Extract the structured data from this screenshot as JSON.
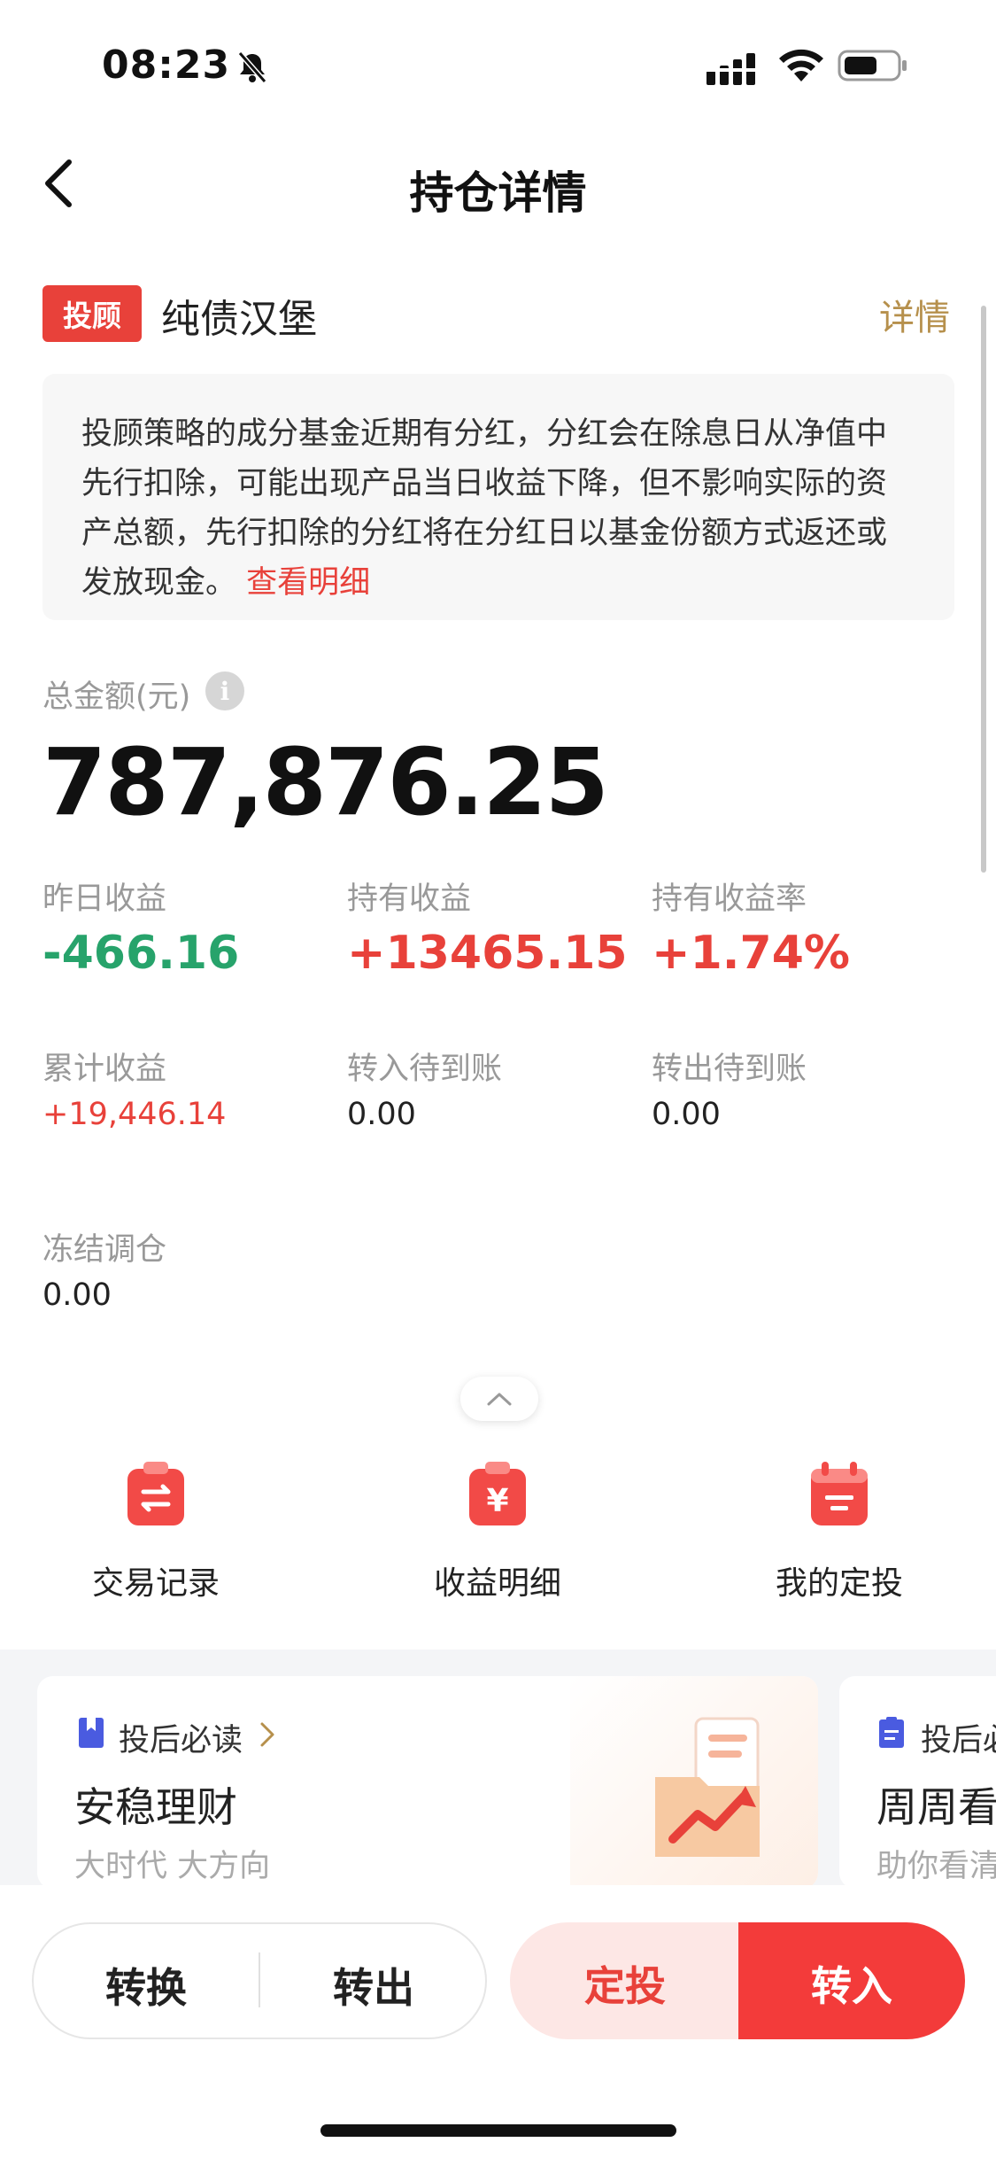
{
  "status_bar": {
    "time": "08:23",
    "icons": [
      "bell-mute-icon",
      "signal-icon",
      "wifi-icon",
      "battery-icon"
    ]
  },
  "nav": {
    "title": "持仓详情",
    "back_icon": "chevron-left-icon"
  },
  "product": {
    "tag": "投顾",
    "name": "纯债汉堡",
    "detail_link": "详情"
  },
  "notice": {
    "text": "投顾策略的成分基金近期有分红，分红会在除息日从净值中先行扣除，可能出现产品当日收益下降，但不影响实际的资产总额，先行扣除的分红将在分红日以基金份额方式返还或发放现金。",
    "link": "查看明细"
  },
  "total": {
    "label": "总金额(元)",
    "info_icon": "i",
    "value": "787,876.25"
  },
  "stats": {
    "yesterday_label": "昨日收益",
    "yesterday_value": "-466.16",
    "holding_label": "持有收益",
    "holding_value": "+13465.15",
    "holding_rate_label": "持有收益率",
    "holding_rate_value": "+1.74%",
    "cumulative_label": "累计收益",
    "cumulative_value": "+19,446.14",
    "transfer_in_label": "转入待到账",
    "transfer_in_value": "0.00",
    "transfer_out_label": "转出待到账",
    "transfer_out_value": "0.00",
    "frozen_label": "冻结调仓",
    "frozen_value": "0.00"
  },
  "shortcuts": [
    {
      "label": "交易记录",
      "icon": "exchange-clipboard-icon"
    },
    {
      "label": "收益明细",
      "icon": "yen-clipboard-icon"
    },
    {
      "label": "我的定投",
      "icon": "calendar-icon"
    }
  ],
  "cards": [
    {
      "kicker": "投后必读",
      "title": "安稳理财",
      "subtitle": "大时代 大方向"
    },
    {
      "kicker": "投后必",
      "title": "周周看",
      "subtitle": "助你看清"
    }
  ],
  "bottom_bar": {
    "convert": "转换",
    "transfer_out": "转出",
    "auto_invest": "定投",
    "transfer_in": "转入"
  },
  "colors": {
    "accent_red": "#e8413a",
    "gain_green": "#27a36b",
    "gold_link": "#b6904c"
  }
}
